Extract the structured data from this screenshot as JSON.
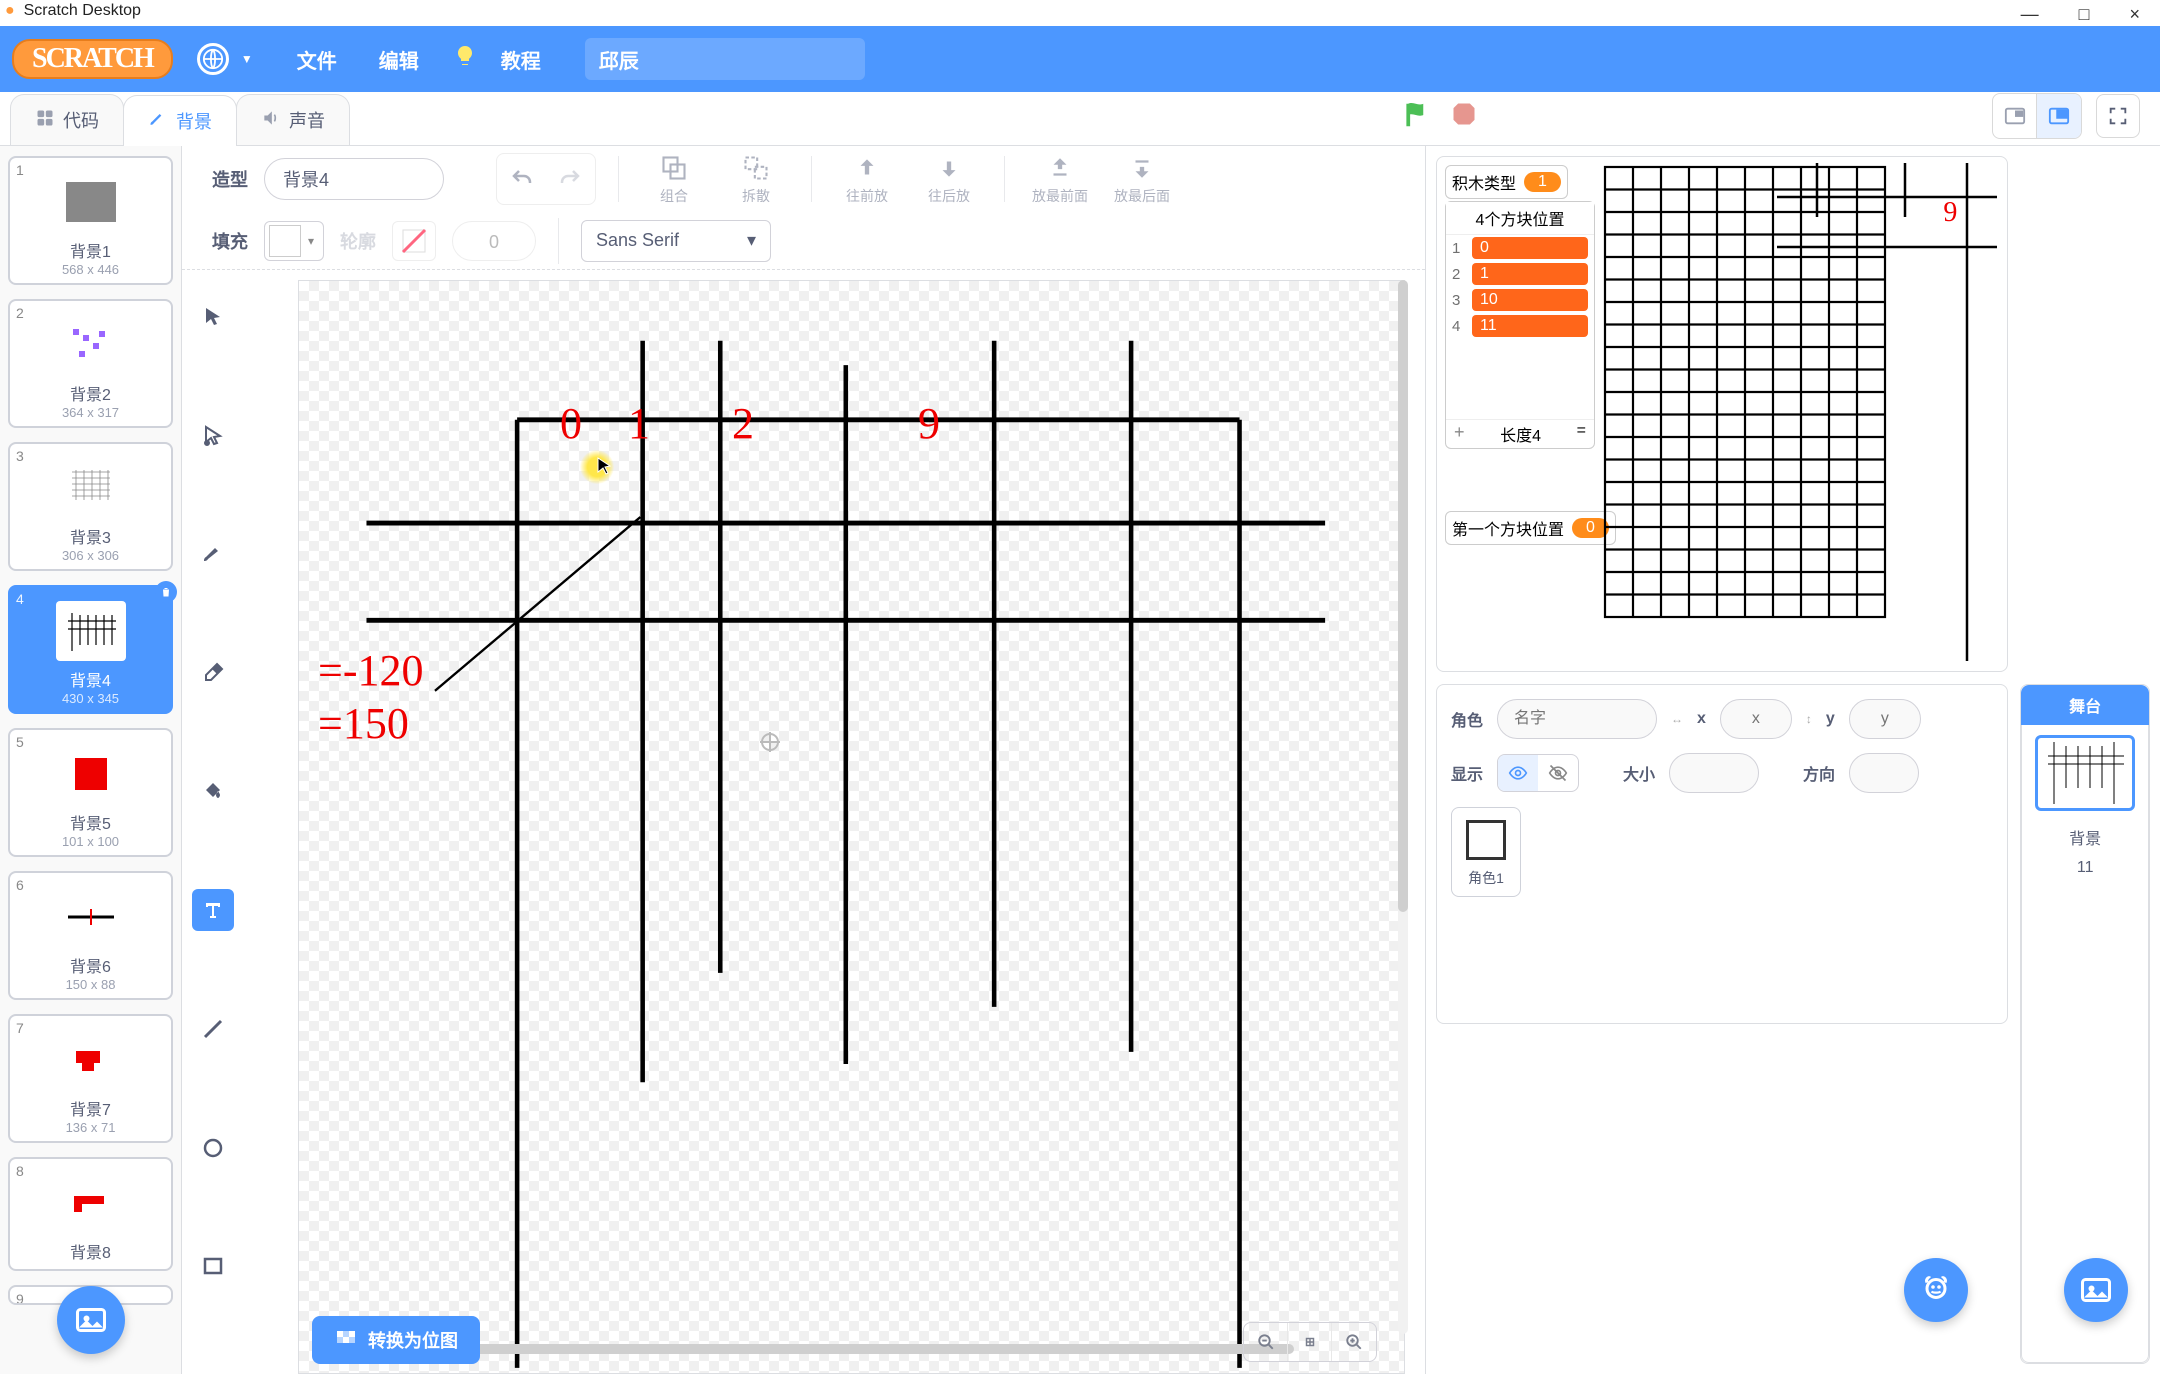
{
  "window": {
    "title": "Scratch Desktop",
    "minimize": "—",
    "maximize": "□",
    "close": "×"
  },
  "menubar": {
    "logo": "SCRATCH",
    "file": "文件",
    "edit": "编辑",
    "tutorials": "教程",
    "project_name": "邱辰"
  },
  "tabs": {
    "code": "代码",
    "costumes": "背景",
    "sounds": "声音"
  },
  "stage_controls": {
    "layout_small": "▫",
    "layout_large": "▪",
    "fullscreen": "⛶"
  },
  "costume_list": [
    {
      "num": "1",
      "name": "背景1",
      "size": "568 x 446"
    },
    {
      "num": "2",
      "name": "背景2",
      "size": "364 x 317"
    },
    {
      "num": "3",
      "name": "背景3",
      "size": "306 x 306"
    },
    {
      "num": "4",
      "name": "背景4",
      "size": "430 x 345"
    },
    {
      "num": "5",
      "name": "背景5",
      "size": "101 x 100"
    },
    {
      "num": "6",
      "name": "背景6",
      "size": "150 x 88"
    },
    {
      "num": "7",
      "name": "背景7",
      "size": "136 x 71"
    },
    {
      "num": "8",
      "name": "背景8",
      "size": ""
    },
    {
      "num": "9",
      "name": "",
      "size": ""
    }
  ],
  "paint": {
    "costume_label": "造型",
    "costume_name": "背景4",
    "group": "组合",
    "ungroup": "拆散",
    "forward": "往前放",
    "backward": "往后放",
    "front": "放最前面",
    "back": "放最后面",
    "fill_label": "填充",
    "outline_label": "轮廓",
    "outline_width": "0",
    "font": "Sans Serif",
    "convert": "转换为位图"
  },
  "canvas_content": {
    "n0": "0",
    "n1": "1",
    "n2": "2",
    "n9": "9",
    "line1": "=-120",
    "line2": "=150"
  },
  "stage_monitors": {
    "var1_label": "积木类型",
    "var1_value": "1",
    "list_label": "4个方块位置",
    "list_items": [
      "0",
      "1",
      "10",
      "11"
    ],
    "len_label": "长度4",
    "len_eq": "=",
    "var2_label": "第一个方块位置",
    "var2_value": "0",
    "stage_num9": "9"
  },
  "sprite_panel": {
    "sprite_label": "角色",
    "name_ph": "名字",
    "x_label": "x",
    "x_ph": "x",
    "y_label": "y",
    "y_ph": "y",
    "show_label": "显示",
    "size_label": "大小",
    "dir_label": "方向",
    "sprite1_name": "角色1"
  },
  "stage_side": {
    "title": "舞台",
    "backdrop_label": "背景",
    "backdrop_count": "11"
  },
  "icon_labels": {
    "plus": "+",
    "minus": "−"
  }
}
